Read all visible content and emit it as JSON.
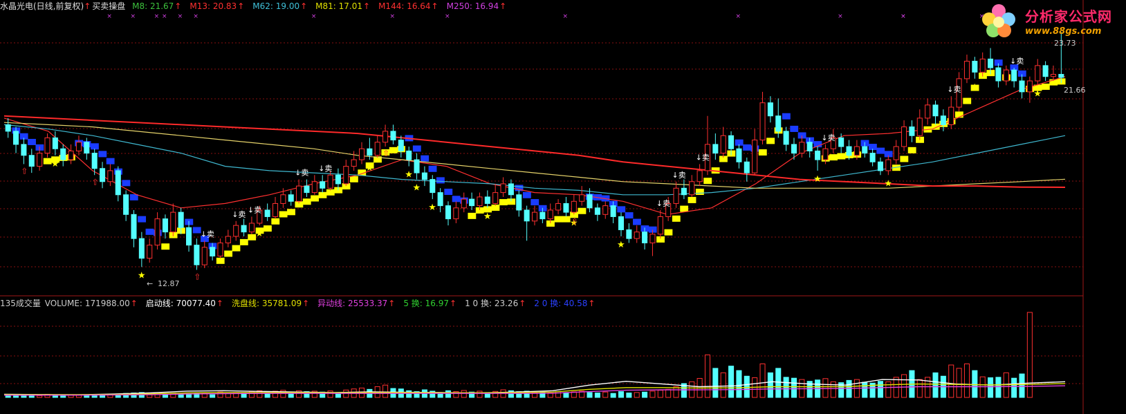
{
  "colors": {
    "up": "#ff3030",
    "down": "#54ffff",
    "ma5": "#ffffff",
    "ma8": "#5fb85f",
    "ma13": "#ff3030",
    "ma62": "#3fb8d0",
    "ma81": "#e6d36a",
    "ma144": "#ff2a2a",
    "ma250": "#c040c0",
    "buy_band": "#ffff00",
    "sell_band": "#1a3cff",
    "grid": "#8a1010"
  },
  "header": {
    "title": "水晶光电(日线,前复权)",
    "indicator": "买卖操盘",
    "ma": [
      {
        "label": "M8: 21.67",
        "color": "#3cc03c"
      },
      {
        "label": "M13: 20.83",
        "color": "#ff3030"
      },
      {
        "label": "M62: 19.00",
        "color": "#3fc0d8"
      },
      {
        "label": "M81: 17.01",
        "color": "#e0e000"
      },
      {
        "label": "M144: 16.64",
        "color": "#ff3030"
      },
      {
        "label": "M250: 16.94",
        "color": "#d040e0"
      }
    ]
  },
  "logo": {
    "line1": "分析家公式网",
    "line2": "www.88gs.com"
  },
  "volume_header": {
    "title": "135成交量",
    "items": [
      {
        "label": "VOLUME: 171988.00",
        "color": "#cccccc"
      },
      {
        "label": "启动线: 70077.40",
        "color": "#ffffff"
      },
      {
        "label": "洗盘线: 35781.09",
        "color": "#e0e000"
      },
      {
        "label": "异动线: 25533.37",
        "color": "#e040e0"
      },
      {
        "label": "5 换: 16.97",
        "color": "#30d030"
      },
      {
        "label": "1 0 换: 23.26",
        "color": "#cccccc"
      },
      {
        "label": "2 0 换: 40.58",
        "color": "#2a40ff"
      }
    ]
  },
  "chart_data": {
    "type": "candlestick",
    "y_range": [
      12,
      24.5
    ],
    "price_labels": {
      "high": "23.73",
      "last": "21.66",
      "low": "12.87"
    },
    "candles": [
      {
        "o": 19.5,
        "c": 19.2,
        "h": 19.8,
        "l": 18.9
      },
      {
        "o": 19.2,
        "c": 18.6,
        "h": 19.4,
        "l": 18.2
      },
      {
        "o": 18.6,
        "c": 18.1,
        "h": 18.9,
        "l": 17.7
      },
      {
        "o": 18.1,
        "c": 17.6,
        "h": 18.4,
        "l": 17.3
      },
      {
        "o": 17.6,
        "c": 18.2,
        "h": 18.5,
        "l": 17.4
      },
      {
        "o": 18.2,
        "c": 18.9,
        "h": 19.1,
        "l": 18.0
      },
      {
        "o": 18.9,
        "c": 18.4,
        "h": 19.2,
        "l": 18.1
      },
      {
        "o": 18.4,
        "c": 17.9,
        "h": 18.6,
        "l": 17.6
      },
      {
        "o": 17.9,
        "c": 18.3,
        "h": 18.6,
        "l": 17.7
      },
      {
        "o": 18.3,
        "c": 18.7,
        "h": 19.0,
        "l": 18.1
      },
      {
        "o": 18.7,
        "c": 18.2,
        "h": 18.9,
        "l": 17.9
      },
      {
        "o": 18.2,
        "c": 17.5,
        "h": 18.4,
        "l": 17.2
      },
      {
        "o": 17.5,
        "c": 16.9,
        "h": 17.8,
        "l": 16.6
      },
      {
        "o": 16.9,
        "c": 17.4,
        "h": 17.7,
        "l": 16.7
      },
      {
        "o": 17.4,
        "c": 16.3,
        "h": 17.6,
        "l": 16.0
      },
      {
        "o": 16.3,
        "c": 15.4,
        "h": 16.5,
        "l": 15.1
      },
      {
        "o": 15.4,
        "c": 14.3,
        "h": 15.6,
        "l": 13.9
      },
      {
        "o": 14.3,
        "c": 13.4,
        "h": 14.6,
        "l": 13.0
      },
      {
        "o": 13.4,
        "c": 14.0,
        "h": 14.3,
        "l": 13.2
      },
      {
        "o": 14.0,
        "c": 15.2,
        "h": 15.5,
        "l": 13.8
      },
      {
        "o": 15.2,
        "c": 14.6,
        "h": 15.4,
        "l": 14.3
      },
      {
        "o": 14.6,
        "c": 15.5,
        "h": 15.9,
        "l": 14.4
      },
      {
        "o": 15.5,
        "c": 14.8,
        "h": 15.7,
        "l": 14.5
      },
      {
        "o": 14.8,
        "c": 14.0,
        "h": 15.1,
        "l": 13.7
      },
      {
        "o": 14.0,
        "c": 13.1,
        "h": 14.3,
        "l": 12.87
      },
      {
        "o": 13.1,
        "c": 13.9,
        "h": 14.2,
        "l": 12.95
      },
      {
        "o": 13.9,
        "c": 13.5,
        "h": 14.1,
        "l": 13.3
      },
      {
        "o": 13.5,
        "c": 14.1,
        "h": 14.3,
        "l": 13.4
      },
      {
        "o": 14.1,
        "c": 14.4,
        "h": 14.7,
        "l": 13.9
      },
      {
        "o": 14.4,
        "c": 14.9,
        "h": 15.1,
        "l": 14.2
      },
      {
        "o": 14.9,
        "c": 14.6,
        "h": 15.2,
        "l": 14.4
      },
      {
        "o": 14.6,
        "c": 15.0,
        "h": 15.3,
        "l": 14.5
      },
      {
        "o": 15.0,
        "c": 15.6,
        "h": 15.8,
        "l": 14.9
      },
      {
        "o": 15.6,
        "c": 15.3,
        "h": 15.9,
        "l": 15.1
      },
      {
        "o": 15.3,
        "c": 15.9,
        "h": 16.2,
        "l": 15.2
      },
      {
        "o": 15.9,
        "c": 16.3,
        "h": 16.6,
        "l": 15.7
      },
      {
        "o": 16.3,
        "c": 16.0,
        "h": 16.5,
        "l": 15.8
      },
      {
        "o": 16.0,
        "c": 16.7,
        "h": 17.0,
        "l": 15.9
      },
      {
        "o": 16.7,
        "c": 16.4,
        "h": 17.0,
        "l": 16.2
      },
      {
        "o": 16.4,
        "c": 16.9,
        "h": 17.2,
        "l": 16.3
      },
      {
        "o": 16.9,
        "c": 16.6,
        "h": 17.2,
        "l": 16.4
      },
      {
        "o": 16.6,
        "c": 17.2,
        "h": 17.4,
        "l": 16.5
      },
      {
        "o": 17.2,
        "c": 16.8,
        "h": 17.5,
        "l": 16.5
      },
      {
        "o": 16.8,
        "c": 17.6,
        "h": 17.9,
        "l": 16.7
      },
      {
        "o": 17.6,
        "c": 17.9,
        "h": 18.3,
        "l": 17.4
      },
      {
        "o": 17.9,
        "c": 18.4,
        "h": 18.7,
        "l": 17.7
      },
      {
        "o": 18.4,
        "c": 18.1,
        "h": 18.9,
        "l": 17.9
      },
      {
        "o": 18.1,
        "c": 18.7,
        "h": 19.0,
        "l": 18.0
      },
      {
        "o": 18.7,
        "c": 19.2,
        "h": 19.5,
        "l": 18.5
      },
      {
        "o": 19.2,
        "c": 18.8,
        "h": 19.5,
        "l": 18.6
      },
      {
        "o": 18.8,
        "c": 18.3,
        "h": 19.0,
        "l": 18.0
      },
      {
        "o": 18.3,
        "c": 17.9,
        "h": 18.5,
        "l": 17.6
      },
      {
        "o": 17.9,
        "c": 17.3,
        "h": 18.2,
        "l": 17.0
      },
      {
        "o": 17.3,
        "c": 17.0,
        "h": 17.6,
        "l": 16.7
      },
      {
        "o": 17.0,
        "c": 16.4,
        "h": 17.2,
        "l": 16.1
      },
      {
        "o": 16.4,
        "c": 15.8,
        "h": 16.6,
        "l": 15.5
      },
      {
        "o": 15.8,
        "c": 15.2,
        "h": 16.0,
        "l": 14.9
      },
      {
        "o": 15.2,
        "c": 15.7,
        "h": 16.0,
        "l": 15.0
      },
      {
        "o": 15.7,
        "c": 16.1,
        "h": 16.4,
        "l": 15.5
      },
      {
        "o": 16.1,
        "c": 15.8,
        "h": 16.4,
        "l": 15.6
      },
      {
        "o": 15.8,
        "c": 16.2,
        "h": 16.4,
        "l": 15.6
      },
      {
        "o": 16.2,
        "c": 15.9,
        "h": 16.5,
        "l": 15.7
      },
      {
        "o": 15.9,
        "c": 16.4,
        "h": 16.8,
        "l": 15.8
      },
      {
        "o": 16.4,
        "c": 16.8,
        "h": 17.1,
        "l": 16.2
      },
      {
        "o": 16.8,
        "c": 16.3,
        "h": 17.0,
        "l": 16.0
      },
      {
        "o": 16.3,
        "c": 15.6,
        "h": 16.5,
        "l": 15.3
      },
      {
        "o": 15.6,
        "c": 15.1,
        "h": 15.8,
        "l": 14.2
      },
      {
        "o": 15.1,
        "c": 15.5,
        "h": 15.8,
        "l": 14.9
      },
      {
        "o": 15.5,
        "c": 15.2,
        "h": 15.7,
        "l": 15.0
      },
      {
        "o": 15.2,
        "c": 15.6,
        "h": 15.9,
        "l": 15.0
      },
      {
        "o": 15.6,
        "c": 15.9,
        "h": 16.1,
        "l": 15.4
      },
      {
        "o": 15.9,
        "c": 15.5,
        "h": 16.2,
        "l": 15.3
      },
      {
        "o": 15.5,
        "c": 16.0,
        "h": 16.3,
        "l": 15.4
      },
      {
        "o": 16.0,
        "c": 16.3,
        "h": 16.7,
        "l": 15.8
      },
      {
        "o": 16.3,
        "c": 15.7,
        "h": 16.6,
        "l": 15.5
      },
      {
        "o": 15.7,
        "c": 15.4,
        "h": 15.9,
        "l": 15.1
      },
      {
        "o": 15.4,
        "c": 15.8,
        "h": 16.0,
        "l": 15.2
      },
      {
        "o": 15.8,
        "c": 15.3,
        "h": 16.0,
        "l": 15.0
      },
      {
        "o": 15.3,
        "c": 14.7,
        "h": 15.5,
        "l": 14.4
      },
      {
        "o": 14.7,
        "c": 14.3,
        "h": 15.0,
        "l": 14.1
      },
      {
        "o": 14.3,
        "c": 14.6,
        "h": 14.9,
        "l": 14.1
      },
      {
        "o": 14.6,
        "c": 14.1,
        "h": 14.8,
        "l": 13.8
      },
      {
        "o": 14.1,
        "c": 14.5,
        "h": 14.7,
        "l": 13.5
      },
      {
        "o": 14.5,
        "c": 15.3,
        "h": 15.6,
        "l": 14.3
      },
      {
        "o": 15.3,
        "c": 15.9,
        "h": 16.2,
        "l": 15.1
      },
      {
        "o": 15.9,
        "c": 16.6,
        "h": 16.9,
        "l": 15.7
      },
      {
        "o": 16.6,
        "c": 16.3,
        "h": 17.0,
        "l": 16.1
      },
      {
        "o": 16.3,
        "c": 16.9,
        "h": 17.2,
        "l": 16.2
      },
      {
        "o": 16.9,
        "c": 17.4,
        "h": 17.7,
        "l": 16.7
      },
      {
        "o": 17.4,
        "c": 18.6,
        "h": 19.9,
        "l": 17.2
      },
      {
        "o": 18.6,
        "c": 18.2,
        "h": 19.1,
        "l": 17.9
      },
      {
        "o": 18.2,
        "c": 19.0,
        "h": 19.4,
        "l": 18.0
      },
      {
        "o": 19.0,
        "c": 18.4,
        "h": 19.2,
        "l": 18.1
      },
      {
        "o": 18.4,
        "c": 17.8,
        "h": 18.6,
        "l": 17.5
      },
      {
        "o": 17.8,
        "c": 17.3,
        "h": 18.0,
        "l": 16.9
      },
      {
        "o": 17.3,
        "c": 18.8,
        "h": 19.3,
        "l": 17.2
      },
      {
        "o": 18.8,
        "c": 20.5,
        "h": 21.0,
        "l": 18.6
      },
      {
        "o": 20.5,
        "c": 19.9,
        "h": 20.8,
        "l": 19.6
      },
      {
        "o": 19.9,
        "c": 19.2,
        "h": 20.7,
        "l": 18.9
      },
      {
        "o": 19.2,
        "c": 18.6,
        "h": 19.4,
        "l": 18.3
      },
      {
        "o": 18.6,
        "c": 18.2,
        "h": 18.9,
        "l": 17.9
      },
      {
        "o": 18.2,
        "c": 18.7,
        "h": 19.0,
        "l": 18.0
      },
      {
        "o": 18.7,
        "c": 18.3,
        "h": 18.9,
        "l": 18.0
      },
      {
        "o": 18.3,
        "c": 17.9,
        "h": 18.5,
        "l": 17.4
      },
      {
        "o": 17.9,
        "c": 18.4,
        "h": 18.6,
        "l": 17.7
      },
      {
        "o": 18.4,
        "c": 18.9,
        "h": 19.3,
        "l": 18.2
      },
      {
        "o": 18.9,
        "c": 18.5,
        "h": 19.1,
        "l": 18.2
      },
      {
        "o": 18.5,
        "c": 18.1,
        "h": 18.8,
        "l": 17.9
      },
      {
        "o": 18.1,
        "c": 18.5,
        "h": 18.8,
        "l": 17.9
      },
      {
        "o": 18.5,
        "c": 18.2,
        "h": 18.7,
        "l": 18.0
      },
      {
        "o": 18.2,
        "c": 17.8,
        "h": 18.4,
        "l": 17.6
      },
      {
        "o": 17.8,
        "c": 17.4,
        "h": 18.0,
        "l": 17.2
      },
      {
        "o": 17.4,
        "c": 17.9,
        "h": 18.1,
        "l": 17.2
      },
      {
        "o": 17.9,
        "c": 18.5,
        "h": 18.8,
        "l": 17.7
      },
      {
        "o": 18.5,
        "c": 19.4,
        "h": 19.7,
        "l": 18.3
      },
      {
        "o": 19.4,
        "c": 19.0,
        "h": 19.7,
        "l": 18.7
      },
      {
        "o": 19.0,
        "c": 19.8,
        "h": 20.2,
        "l": 18.8
      },
      {
        "o": 19.8,
        "c": 20.4,
        "h": 20.7,
        "l": 19.5
      },
      {
        "o": 20.4,
        "c": 19.9,
        "h": 20.6,
        "l": 19.5
      },
      {
        "o": 19.9,
        "c": 19.5,
        "h": 20.2,
        "l": 19.2
      },
      {
        "o": 19.5,
        "c": 20.3,
        "h": 20.8,
        "l": 19.3
      },
      {
        "o": 20.3,
        "c": 21.6,
        "h": 21.9,
        "l": 20.1
      },
      {
        "o": 21.6,
        "c": 22.4,
        "h": 22.7,
        "l": 21.4
      },
      {
        "o": 22.4,
        "c": 21.9,
        "h": 22.6,
        "l": 21.6
      },
      {
        "o": 21.9,
        "c": 22.5,
        "h": 22.8,
        "l": 21.7
      },
      {
        "o": 22.5,
        "c": 22.1,
        "h": 23.0,
        "l": 21.8
      },
      {
        "o": 22.1,
        "c": 21.5,
        "h": 22.3,
        "l": 21.2
      },
      {
        "o": 21.5,
        "c": 22.0,
        "h": 22.2,
        "l": 21.3
      },
      {
        "o": 22.0,
        "c": 21.5,
        "h": 22.1,
        "l": 21.2
      },
      {
        "o": 21.5,
        "c": 21.0,
        "h": 21.8,
        "l": 20.7
      },
      {
        "o": 21.0,
        "c": 21.5,
        "h": 21.7,
        "l": 20.5
      },
      {
        "o": 21.5,
        "c": 22.2,
        "h": 22.5,
        "l": 21.3
      },
      {
        "o": 22.2,
        "c": 21.7,
        "h": 22.4,
        "l": 21.5
      },
      {
        "o": 21.7,
        "c": 21.8,
        "h": 22.2,
        "l": 21.5
      },
      {
        "o": 21.8,
        "c": 21.66,
        "h": 23.73,
        "l": 21.4
      }
    ],
    "ma_series": [
      {
        "name": "M13",
        "color": "#ff3030",
        "values": [
          19.8,
          19.2,
          17.4,
          16.3,
          15.7,
          15.9,
          16.3,
          16.8,
          17.2,
          17.9,
          17.6,
          16.8,
          16.4,
          16.3,
          16.0,
          15.4,
          15.7,
          16.8,
          18.2,
          19.0,
          19.1,
          19.3,
          20.2,
          21.1,
          21.7
        ]
      },
      {
        "name": "M62",
        "color": "#3fb8d0",
        "values": [
          19.5,
          19.3,
          19.0,
          18.6,
          18.2,
          17.6,
          17.4,
          17.3,
          17.2,
          17.0,
          16.9,
          16.8,
          16.6,
          16.5,
          16.3,
          16.3,
          16.4,
          16.6,
          16.9,
          17.2,
          17.5,
          17.8,
          18.2,
          18.6,
          19.0
        ]
      },
      {
        "name": "M81",
        "color": "#e6d36a",
        "values": [
          19.6,
          19.5,
          19.4,
          19.2,
          19.0,
          18.8,
          18.6,
          18.4,
          18.1,
          17.9,
          17.7,
          17.5,
          17.3,
          17.1,
          16.9,
          16.8,
          16.7,
          16.6,
          16.6,
          16.6,
          16.6,
          16.7,
          16.8,
          16.9,
          17.01
        ]
      },
      {
        "name": "M144",
        "color": "#ff2a2a",
        "values": [
          19.9,
          19.8,
          19.7,
          19.6,
          19.5,
          19.4,
          19.3,
          19.2,
          19.1,
          18.9,
          18.7,
          18.5,
          18.3,
          18.1,
          17.8,
          17.6,
          17.4,
          17.2,
          17.0,
          16.9,
          16.8,
          16.7,
          16.7,
          16.65,
          16.64
        ]
      }
    ],
    "volume": {
      "max": 380000,
      "bars": [
        12,
        10,
        9,
        11,
        8,
        14,
        12,
        9,
        10,
        11,
        8,
        9,
        10,
        14,
        12,
        18,
        20,
        22,
        15,
        21,
        14,
        18,
        12,
        16,
        20,
        18,
        12,
        24,
        17,
        22,
        19,
        26,
        30,
        22,
        28,
        32,
        24,
        30,
        26,
        28,
        24,
        29,
        22,
        33,
        38,
        42,
        36,
        48,
        55,
        40,
        38,
        30,
        26,
        34,
        28,
        22,
        30,
        26,
        31,
        24,
        28,
        22,
        27,
        34,
        30,
        26,
        28,
        22,
        24,
        20,
        26,
        22,
        25,
        28,
        22,
        20,
        24,
        18,
        26,
        20,
        22,
        24,
        28,
        32,
        36,
        48,
        62,
        70,
        85,
        190,
        130,
        110,
        140,
        120,
        95,
        88,
        150,
        110,
        130,
        90,
        86,
        80,
        72,
        78,
        84,
        70,
        66,
        76,
        80,
        68,
        64,
        72,
        70,
        90,
        102,
        120,
        80,
        90,
        110,
        95,
        145,
        130,
        150,
        120,
        92,
        88,
        90,
        110,
        86,
        105,
        380
      ]
    },
    "volume_lines": [
      {
        "name": "启动线",
        "color": "#ffffff",
        "values": [
          14,
          13,
          12,
          15,
          20,
          28,
          30,
          27,
          24,
          22,
          25,
          23,
          22,
          20,
          24,
          30,
          55,
          72,
          60,
          48,
          52,
          70,
          60,
          55,
          80,
          78,
          60,
          55,
          64,
          70
        ]
      },
      {
        "name": "洗盘线",
        "color": "#e0e000",
        "values": [
          12,
          12,
          12,
          13,
          16,
          20,
          22,
          22,
          22,
          21,
          22,
          22,
          21,
          21,
          22,
          24,
          36,
          44,
          44,
          42,
          43,
          48,
          48,
          48,
          56,
          60,
          58,
          56,
          58,
          62
        ]
      },
      {
        "name": "异动线",
        "color": "#e040e0",
        "values": [
          10,
          10,
          10,
          11,
          12,
          15,
          17,
          18,
          18,
          18,
          18,
          18,
          18,
          18,
          18,
          19,
          26,
          32,
          34,
          34,
          35,
          38,
          39,
          40,
          44,
          48,
          48,
          48,
          49,
          52
        ]
      }
    ],
    "signals": {
      "sell_label": "卖",
      "stars": [
        6,
        17,
        32,
        46,
        51,
        52,
        54,
        61,
        72,
        78,
        103,
        112,
        123,
        131,
        137
      ],
      "sells": [
        25,
        29,
        31,
        37,
        40,
        83,
        85,
        88,
        104,
        120,
        128
      ],
      "up_arrows": [
        2,
        11,
        24,
        48,
        72
      ],
      "marker_top_char": "×"
    }
  }
}
